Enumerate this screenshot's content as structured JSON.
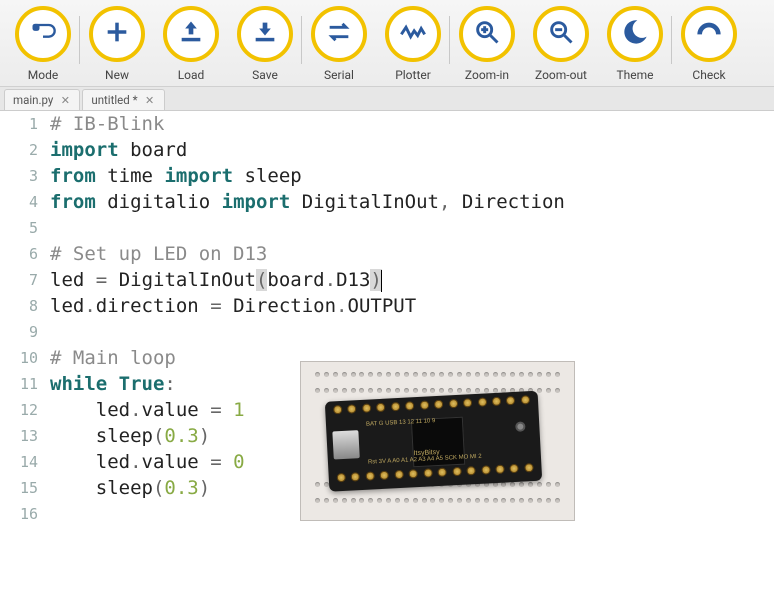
{
  "toolbar": {
    "items": [
      {
        "label": "Mode",
        "icon": "mode",
        "sep": true
      },
      {
        "label": "New",
        "icon": "plus"
      },
      {
        "label": "Load",
        "icon": "load"
      },
      {
        "label": "Save",
        "icon": "save",
        "sep": true
      },
      {
        "label": "Serial",
        "icon": "serial"
      },
      {
        "label": "Plotter",
        "icon": "plotter",
        "sep": true
      },
      {
        "label": "Zoom-in",
        "icon": "zoom-in"
      },
      {
        "label": "Zoom-out",
        "icon": "zoom-out"
      },
      {
        "label": "Theme",
        "icon": "theme",
        "sep": true
      },
      {
        "label": "Check",
        "icon": "check"
      }
    ],
    "accent": "#f2c200",
    "icon_color": "#2b5a9e"
  },
  "tabs": [
    {
      "label": "main.py",
      "dirty": false
    },
    {
      "label": "untitled *",
      "dirty": true
    }
  ],
  "code": {
    "lines": [
      {
        "n": 1,
        "t": "# IB-Blink",
        "cls": "comment"
      },
      {
        "n": 2,
        "t": "import board"
      },
      {
        "n": 3,
        "t": "from time import sleep"
      },
      {
        "n": 4,
        "t": "from digitalio import DigitalInOut, Direction"
      },
      {
        "n": 5,
        "t": ""
      },
      {
        "n": 6,
        "t": "# Set up LED on D13",
        "cls": "comment"
      },
      {
        "n": 7,
        "t": "led = DigitalInOut(board.D13)",
        "cursor": true
      },
      {
        "n": 8,
        "t": "led.direction = Direction.OUTPUT"
      },
      {
        "n": 9,
        "t": ""
      },
      {
        "n": 10,
        "t": "# Main loop",
        "cls": "comment"
      },
      {
        "n": 11,
        "t": "while True:"
      },
      {
        "n": 12,
        "t": "    led.value = 1"
      },
      {
        "n": 13,
        "t": "    sleep(0.3)"
      },
      {
        "n": 14,
        "t": "    led.value = 0"
      },
      {
        "n": 15,
        "t": "    sleep(0.3)"
      },
      {
        "n": 16,
        "t": ""
      }
    ]
  },
  "overlay_image": {
    "alt": "ItsyBitsy microcontroller on breadboard"
  }
}
